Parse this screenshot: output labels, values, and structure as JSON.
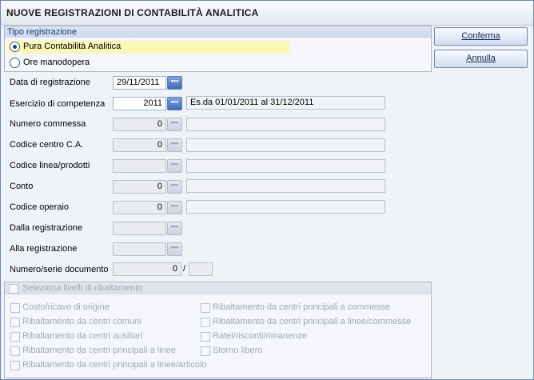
{
  "window": {
    "title": "NUOVE REGISTRAZIONI DI CONTABILITÀ ANALITICA"
  },
  "tipo": {
    "heading": "Tipo registrazione",
    "options": [
      {
        "label": "Pura Contabilità Analitica",
        "selected": true
      },
      {
        "label": "Ore manodopera",
        "selected": false
      }
    ]
  },
  "buttons": {
    "confirm": "Conferma",
    "cancel": "Annulla"
  },
  "fields": {
    "data_reg": {
      "label": "Data di registrazione",
      "value": "29/11/2011"
    },
    "esercizio": {
      "label": "Esercizio di competenza",
      "value": "2011",
      "desc": "Es.da 01/01/2011 al 31/12/2011"
    },
    "commessa": {
      "label": "Numero commessa",
      "value": "0"
    },
    "centro": {
      "label": "Codice centro C.A.",
      "value": "0"
    },
    "linea": {
      "label": "Codice linea/prodotti"
    },
    "conto": {
      "label": "Conto",
      "value": "0"
    },
    "operaio": {
      "label": "Codice operaio",
      "value": "0"
    },
    "dalla": {
      "label": "Dalla registrazione"
    },
    "alla": {
      "label": "Alla registrazione"
    },
    "documento": {
      "label": "Numero/serie documento",
      "value": "0",
      "separator": "/"
    }
  },
  "ribaltamento": {
    "heading": "Seleziona livelli di ribaltamento",
    "left": [
      "Costo/ricavo di origine",
      "Ribaltamento da centri comuni",
      "Ribaltamento da centri ausiliari",
      "Ribaltamento da centri principali a linee",
      "Ribaltamento da centri principali a linee/articolo"
    ],
    "right": [
      "Ribaltamento da centri principali a commesse",
      "Ribaltamento da centri principali a linee/commesse",
      "Ratei/risconti/rimanenze",
      "Storno libero"
    ]
  },
  "icons": {
    "lookup": "ellipsis-icon",
    "radio": "radio-icon",
    "checkbox": "checkbox-icon"
  }
}
